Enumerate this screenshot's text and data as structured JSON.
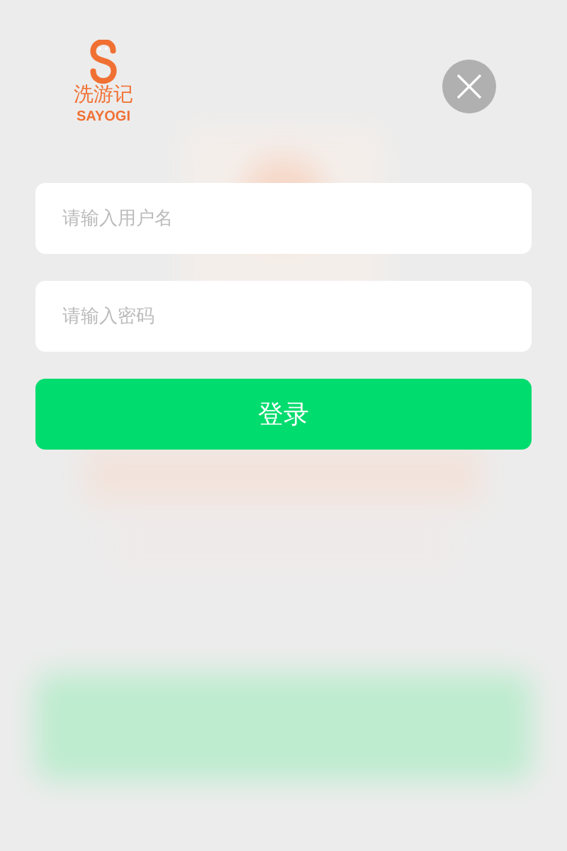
{
  "logo": {
    "name": "洗游记",
    "wordmark": "SAYOGI"
  },
  "fields": [
    {
      "placeholder": "请输入用户名"
    },
    {
      "placeholder": "请输入密码"
    }
  ],
  "login_button": {
    "label": "登录"
  }
}
